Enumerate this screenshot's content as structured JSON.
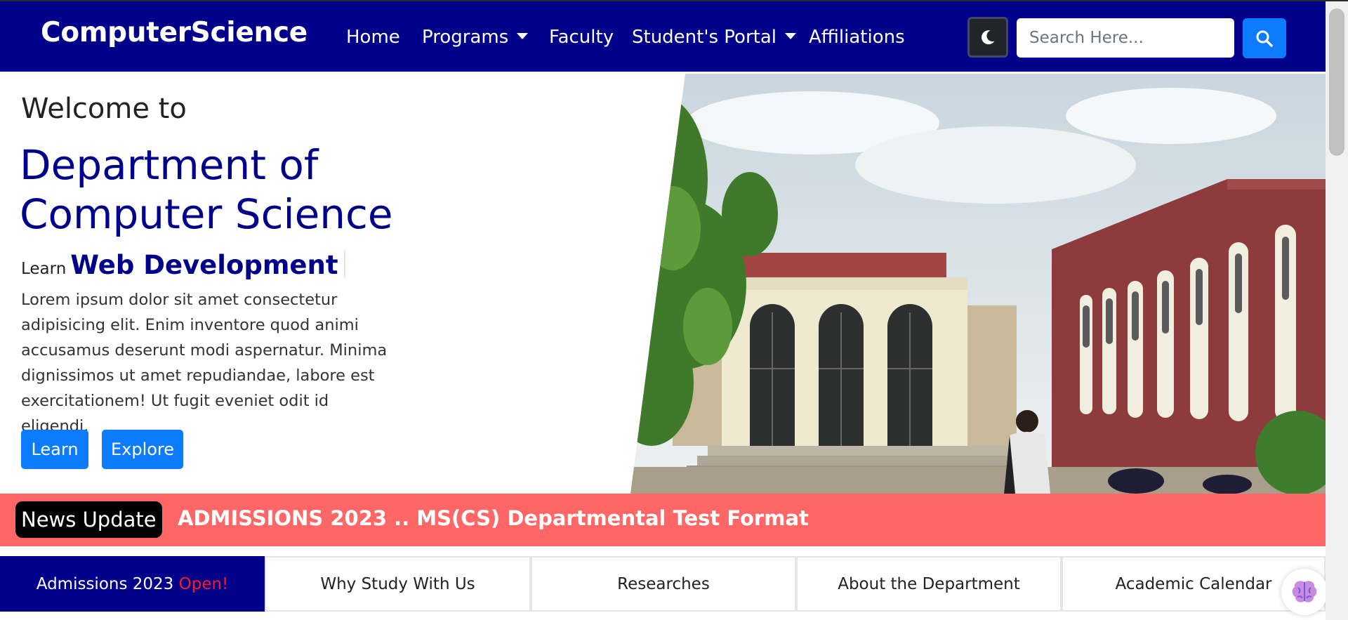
{
  "brand": "ComputerScience",
  "nav": {
    "items": [
      {
        "label": "Home",
        "dropdown": false
      },
      {
        "label": "Programs",
        "dropdown": true
      },
      {
        "label": "Faculty",
        "dropdown": false
      },
      {
        "label": "Student's Portal",
        "dropdown": true
      },
      {
        "label": "Affiliations",
        "dropdown": false
      }
    ]
  },
  "theme_toggle_icon": "moon-icon",
  "search": {
    "placeholder": "Search Here...",
    "value": "",
    "button_icon": "search-icon"
  },
  "hero": {
    "welcome": "Welcome to",
    "department": "Department of Computer Science",
    "learn_prefix": "Learn",
    "learn_topic": "Web Development",
    "body": "Lorem ipsum dolor sit amet consectetur adipisicing elit. Enim inventore quod animi accusamus deserunt modi aspernatur. Minima dignissimos ut amet repudiandae, labore est exercitationem! Ut fugit eveniet odit id eligendi.",
    "buttons": [
      "Learn",
      "Explore"
    ],
    "image": "department-building-photo"
  },
  "news": {
    "badge": "News Update",
    "headline": "ADMISSIONS 2023 .. MS(CS) Departmental Test Format"
  },
  "tabs": [
    {
      "label": "Admissions 2023",
      "highlight": "Open!",
      "active": true
    },
    {
      "label": "Why Study With Us",
      "active": false
    },
    {
      "label": "Researches",
      "active": false
    },
    {
      "label": "About the Department",
      "active": false
    },
    {
      "label": "Academic Calendar",
      "active": false
    }
  ],
  "colors": {
    "navbar": "#00008b",
    "primary_button": "#0d7bff",
    "news_bar": "#ff6666",
    "open_text": "#ff1a1a"
  }
}
